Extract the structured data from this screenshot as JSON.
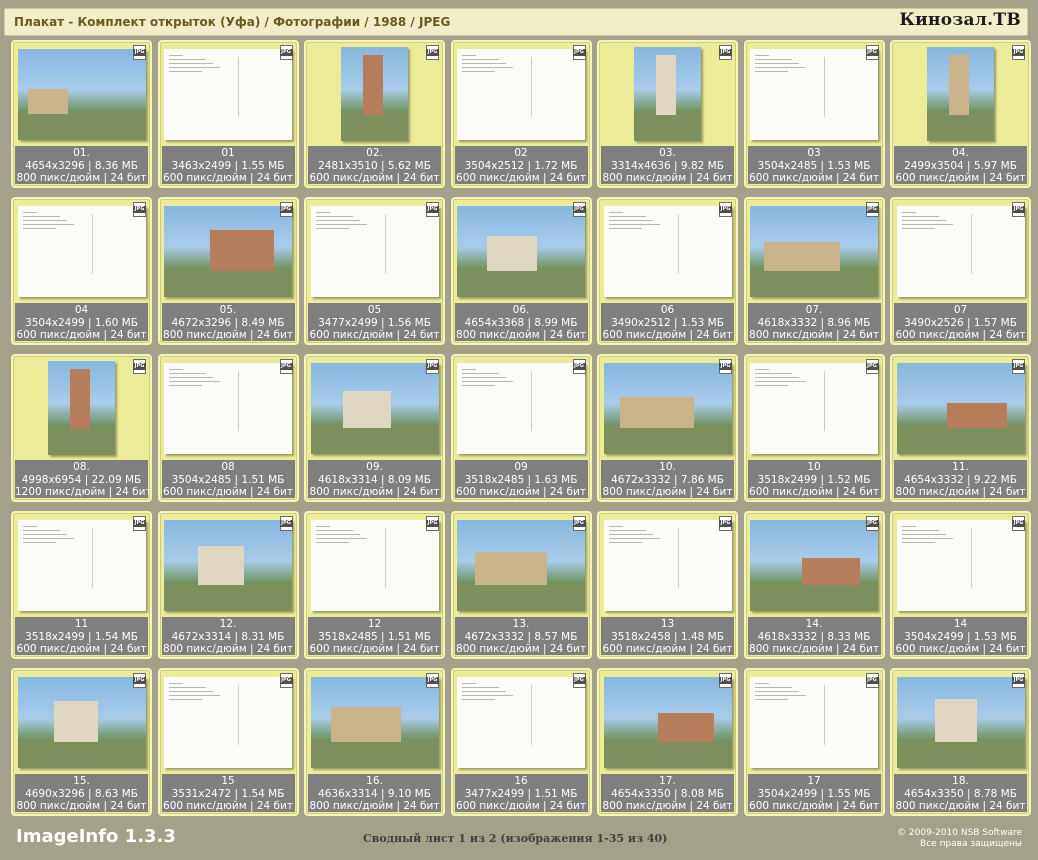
{
  "header": {
    "title": "Плакат - Комплект открыток (Уфа) / Фотографии / 1988 / JPEG",
    "brand": "Кинозал.ТВ"
  },
  "badge_text": "JPG",
  "thumbnails": [
    {
      "label": "01.",
      "dims": "4654x3296 | 8.36 МБ",
      "dpi": "800 пикс/дюйм | 24 бит",
      "kind": "photo",
      "orient": "land"
    },
    {
      "label": "01",
      "dims": "3463x2499 | 1.55 МБ",
      "dpi": "600 пикс/дюйм | 24 бит",
      "kind": "back",
      "orient": "land"
    },
    {
      "label": "02.",
      "dims": "2481x3510 | 5.62 МБ",
      "dpi": "600 пикс/дюйм | 24 бит",
      "kind": "photo",
      "orient": "port"
    },
    {
      "label": "02",
      "dims": "3504x2512 | 1.72 МБ",
      "dpi": "600 пикс/дюйм | 24 бит",
      "kind": "back",
      "orient": "land"
    },
    {
      "label": "03.",
      "dims": "3314x4636 | 9.82 МБ",
      "dpi": "800 пикс/дюйм | 24 бит",
      "kind": "photo",
      "orient": "port"
    },
    {
      "label": "03",
      "dims": "3504x2485 | 1.53 МБ",
      "dpi": "600 пикс/дюйм | 24 бит",
      "kind": "back",
      "orient": "land"
    },
    {
      "label": "04.",
      "dims": "2499x3504 | 5.97 МБ",
      "dpi": "600 пикс/дюйм | 24 бит",
      "kind": "photo",
      "orient": "port"
    },
    {
      "label": "04",
      "dims": "3504x2499 | 1.60 МБ",
      "dpi": "600 пикс/дюйм | 24 бит",
      "kind": "back",
      "orient": "land"
    },
    {
      "label": "05.",
      "dims": "4672x3296 | 8.49 МБ",
      "dpi": "800 пикс/дюйм | 24 бит",
      "kind": "photo",
      "orient": "land"
    },
    {
      "label": "05",
      "dims": "3477x2499 | 1.56 МБ",
      "dpi": "600 пикс/дюйм | 24 бит",
      "kind": "back",
      "orient": "land"
    },
    {
      "label": "06.",
      "dims": "4654x3368 | 8.99 МБ",
      "dpi": "800 пикс/дюйм | 24 бит",
      "kind": "photo",
      "orient": "land"
    },
    {
      "label": "06",
      "dims": "3490x2512 | 1.53 МБ",
      "dpi": "600 пикс/дюйм | 24 бит",
      "kind": "back",
      "orient": "land"
    },
    {
      "label": "07.",
      "dims": "4618x3332 | 8.96 МБ",
      "dpi": "800 пикс/дюйм | 24 бит",
      "kind": "photo",
      "orient": "land"
    },
    {
      "label": "07",
      "dims": "3490x2526 | 1.57 МБ",
      "dpi": "600 пикс/дюйм | 24 бит",
      "kind": "back",
      "orient": "land"
    },
    {
      "label": "08.",
      "dims": "4998x6954 | 22.09 МБ",
      "dpi": "1200 пикс/дюйм | 24 бит",
      "kind": "photo",
      "orient": "port"
    },
    {
      "label": "08",
      "dims": "3504x2485 | 1.51 МБ",
      "dpi": "600 пикс/дюйм | 24 бит",
      "kind": "back",
      "orient": "land"
    },
    {
      "label": "09.",
      "dims": "4618x3314 | 8.09 МБ",
      "dpi": "800 пикс/дюйм | 24 бит",
      "kind": "photo",
      "orient": "land"
    },
    {
      "label": "09",
      "dims": "3518x2485 | 1.63 МБ",
      "dpi": "600 пикс/дюйм | 24 бит",
      "kind": "back",
      "orient": "land"
    },
    {
      "label": "10.",
      "dims": "4672x3332 | 7.86 МБ",
      "dpi": "800 пикс/дюйм | 24 бит",
      "kind": "photo",
      "orient": "land"
    },
    {
      "label": "10",
      "dims": "3518x2499 | 1.52 МБ",
      "dpi": "600 пикс/дюйм | 24 бит",
      "kind": "back",
      "orient": "land"
    },
    {
      "label": "11.",
      "dims": "4654x3332 | 9.22 МБ",
      "dpi": "800 пикс/дюйм | 24 бит",
      "kind": "photo",
      "orient": "land"
    },
    {
      "label": "11",
      "dims": "3518x2499 | 1.54 МБ",
      "dpi": "600 пикс/дюйм | 24 бит",
      "kind": "back",
      "orient": "land"
    },
    {
      "label": "12.",
      "dims": "4672x3314 | 8.31 МБ",
      "dpi": "800 пикс/дюйм | 24 бит",
      "kind": "photo",
      "orient": "land"
    },
    {
      "label": "12",
      "dims": "3518x2485 | 1.51 МБ",
      "dpi": "600 пикс/дюйм | 24 бит",
      "kind": "back",
      "orient": "land"
    },
    {
      "label": "13.",
      "dims": "4672x3332 | 8.57 МБ",
      "dpi": "800 пикс/дюйм | 24 бит",
      "kind": "photo",
      "orient": "land"
    },
    {
      "label": "13",
      "dims": "3518x2458 | 1.48 МБ",
      "dpi": "600 пикс/дюйм | 24 бит",
      "kind": "back",
      "orient": "land"
    },
    {
      "label": "14.",
      "dims": "4618x3332 | 8.33 МБ",
      "dpi": "800 пикс/дюйм | 24 бит",
      "kind": "photo",
      "orient": "land"
    },
    {
      "label": "14",
      "dims": "3504x2499 | 1.53 МБ",
      "dpi": "600 пикс/дюйм | 24 бит",
      "kind": "back",
      "orient": "land"
    },
    {
      "label": "15.",
      "dims": "4690x3296 | 8.63 МБ",
      "dpi": "800 пикс/дюйм | 24 бит",
      "kind": "photo",
      "orient": "land"
    },
    {
      "label": "15",
      "dims": "3531x2472 | 1.54 МБ",
      "dpi": "600 пикс/дюйм | 24 бит",
      "kind": "back",
      "orient": "land"
    },
    {
      "label": "16.",
      "dims": "4636x3314 | 9.10 МБ",
      "dpi": "800 пикс/дюйм | 24 бит",
      "kind": "photo",
      "orient": "land"
    },
    {
      "label": "16",
      "dims": "3477x2499 | 1.51 МБ",
      "dpi": "600 пикс/дюйм | 24 бит",
      "kind": "back",
      "orient": "land"
    },
    {
      "label": "17.",
      "dims": "4654x3350 | 8.08 МБ",
      "dpi": "800 пикс/дюйм | 24 бит",
      "kind": "photo",
      "orient": "land"
    },
    {
      "label": "17",
      "dims": "3504x2499 | 1.55 МБ",
      "dpi": "600 пикс/дюйм | 24 бит",
      "kind": "back",
      "orient": "land"
    },
    {
      "label": "18.",
      "dims": "4654x3350 | 8.78 МБ",
      "dpi": "800 пикс/дюйм | 24 бит",
      "kind": "photo",
      "orient": "land"
    }
  ],
  "footer": {
    "app_name": "ImageInfo 1.3.3",
    "sheet_info": "Сводный лист 1 из 2 (изображения 1-35 из 40)",
    "copyright_line1": "© 2009-2010 NSB Software",
    "copyright_line2": "Все права защищены"
  },
  "colors": {
    "background": "#a4a18a",
    "card": "#ecec98",
    "info_bar": "#7f7f7f",
    "header_bg": "#f2edc9",
    "header_text": "#6b5a1c"
  }
}
